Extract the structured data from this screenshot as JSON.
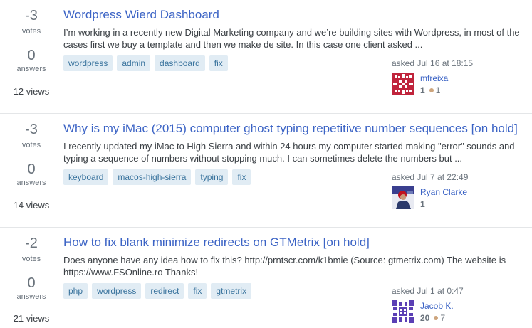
{
  "questions": [
    {
      "votes": "-3",
      "votes_label": "votes",
      "answers": "0",
      "answers_label": "answers",
      "views": "12 views",
      "title": "Wordpress Wierd Dashboard",
      "excerpt": "I’m working in a recently new Digital Marketing company and we’re building sites with Wordpress, in most of the cases first we buy a template and then we make de site. In this case one client asked ...",
      "tags": [
        "wordpress",
        "admin",
        "dashboard",
        "fix"
      ],
      "asked": "asked Jul 16 at 18:15",
      "user": {
        "name": "mfreixa",
        "rep": "1",
        "bronze": "1",
        "avatar_color": "#c0243c"
      }
    },
    {
      "votes": "-3",
      "votes_label": "votes",
      "answers": "0",
      "answers_label": "answers",
      "views": "14 views",
      "title": "Why is my iMac (2015) computer ghost typing repetitive number sequences [on hold]",
      "excerpt": "I recently updated my iMac to High Sierra and within 24 hours my computer started making \"error\" sounds and typing a sequence of numbers without stopping much. I can sometimes delete the numbers but ...",
      "tags": [
        "keyboard",
        "macos-high-sierra",
        "typing",
        "fix"
      ],
      "asked": "asked Jul 7 at 22:49",
      "user": {
        "name": "Ryan Clarke",
        "rep": "1",
        "bronze": "",
        "avatar_color": "#3a3f8f"
      }
    },
    {
      "votes": "-2",
      "votes_label": "votes",
      "answers": "0",
      "answers_label": "answers",
      "views": "21 views",
      "title": "How to fix blank minimize redirects on GTMetrix [on hold]",
      "excerpt": "Does anyone have any idea how to fix this? http://prntscr.com/k1bmie (Source: gtmetrix.com) The website is https://www.FSOnline.ro Thanks!",
      "tags": [
        "php",
        "wordpress",
        "redirect",
        "fix",
        "gtmetrix"
      ],
      "asked": "asked Jul 1 at 0:47",
      "user": {
        "name": "Jacob K.",
        "rep": "20",
        "bronze": "7",
        "avatar_color": "#5b3fb5"
      }
    }
  ]
}
